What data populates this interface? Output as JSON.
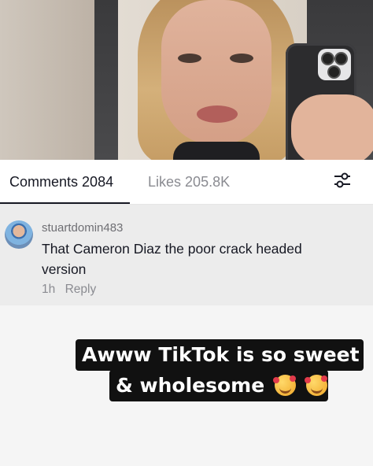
{
  "tabs": {
    "comments_label": "Comments",
    "comments_count": "2084",
    "likes_label": "Likes",
    "likes_count": "205.8K",
    "filter_icon": "filter-sliders-icon"
  },
  "comment": {
    "username": "stuartdomin483",
    "text": "That Cameron Diaz the poor crack headed version",
    "time": "1h",
    "reply_label": "Reply"
  },
  "caption": {
    "line1": "Awww TikTok is so sweet",
    "line2": "& wholesome",
    "emoji_icons": [
      "smiling-face-with-hearts-icon",
      "smiling-face-with-hearts-icon"
    ]
  },
  "colors": {
    "primary_text": "#161823",
    "secondary_text": "#8a8b91",
    "comment_bg": "#ececec",
    "caption_bg": "#111111"
  }
}
